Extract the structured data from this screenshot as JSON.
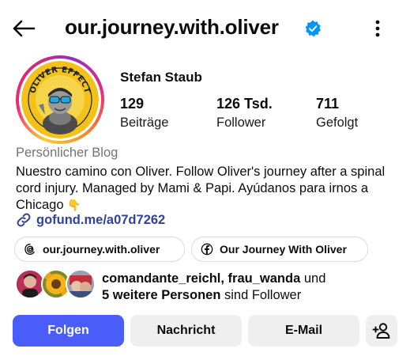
{
  "header": {
    "username": "our.journey.with.oliver",
    "verified": true
  },
  "profile": {
    "display_name": "Stefan Staub",
    "avatar_text": "OLIVER EFFECT",
    "stats": [
      {
        "value": "129",
        "label": "Beiträge"
      },
      {
        "value": "126 Tsd.",
        "label": "Follower"
      },
      {
        "value": "711",
        "label": "Gefolgt"
      }
    ],
    "category": "Persönlicher Blog",
    "bio": "Nuestro camino con Oliver. Follow Oliver's journey after a spinal cord injury. Managed by Mami & Papi. Ayúdanos para irnos a Chicago",
    "bio_emoji": "👇",
    "link": "gofund.me/a07d7262"
  },
  "chips": {
    "threads": "our.journey.with.oliver",
    "facebook": "Our Journey With Oliver"
  },
  "mutual": {
    "names": "comandante_reichl, frau_wanda",
    "and": "und",
    "others": "5 weitere Personen",
    "suffix": "sind Follower"
  },
  "actions": {
    "follow": "Folgen",
    "message": "Nachricht",
    "email": "E-Mail"
  },
  "colors": {
    "accent": "#4a5df9",
    "link": "#30429b",
    "verified": "#0095f6",
    "secondary_button": "#efefef",
    "muted_text": "#737373"
  },
  "icons": [
    "back-arrow-icon",
    "verified-badge-icon",
    "more-vertical-icon",
    "link-icon",
    "threads-icon",
    "facebook-icon",
    "add-person-icon"
  ]
}
